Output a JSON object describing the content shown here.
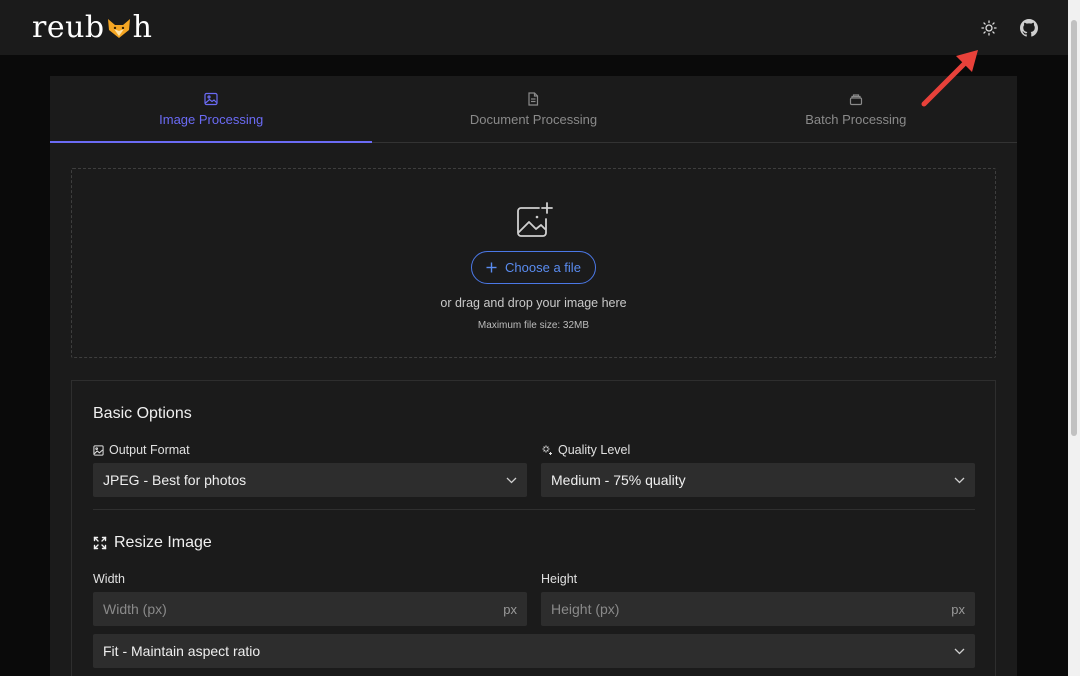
{
  "header": {
    "logo_text_left": "reub",
    "logo_text_right": "h",
    "icons": [
      "fox-logo-icon",
      "theme-toggle-sun-icon",
      "github-icon"
    ]
  },
  "tabs": [
    {
      "label": "Image Processing",
      "icon": "image-icon",
      "active": true
    },
    {
      "label": "Document Processing",
      "icon": "document-icon",
      "active": false
    },
    {
      "label": "Batch Processing",
      "icon": "layers-icon",
      "active": false
    }
  ],
  "dropzone": {
    "icon": "image-add-icon",
    "button_label": "Choose a file",
    "hint": "or drag and drop your image here",
    "max_size": "Maximum file size: 32MB"
  },
  "options": {
    "basic_title": "Basic Options",
    "output_format": {
      "label": "Output Format",
      "value": "JPEG - Best for photos"
    },
    "quality_level": {
      "label": "Quality Level",
      "value": "Medium - 75% quality"
    },
    "resize_title": "Resize Image",
    "width": {
      "label": "Width",
      "placeholder": "Width (px)",
      "unit": "px"
    },
    "height": {
      "label": "Height",
      "placeholder": "Height (px)",
      "unit": "px"
    },
    "fit_mode": {
      "value": "Fit - Maintain aspect ratio"
    }
  },
  "colors": {
    "accent": "#6b6bf5",
    "button_blue": "#5a8cf0",
    "annotation_arrow": "#e8413a",
    "fox_orange": "#f5a623"
  }
}
